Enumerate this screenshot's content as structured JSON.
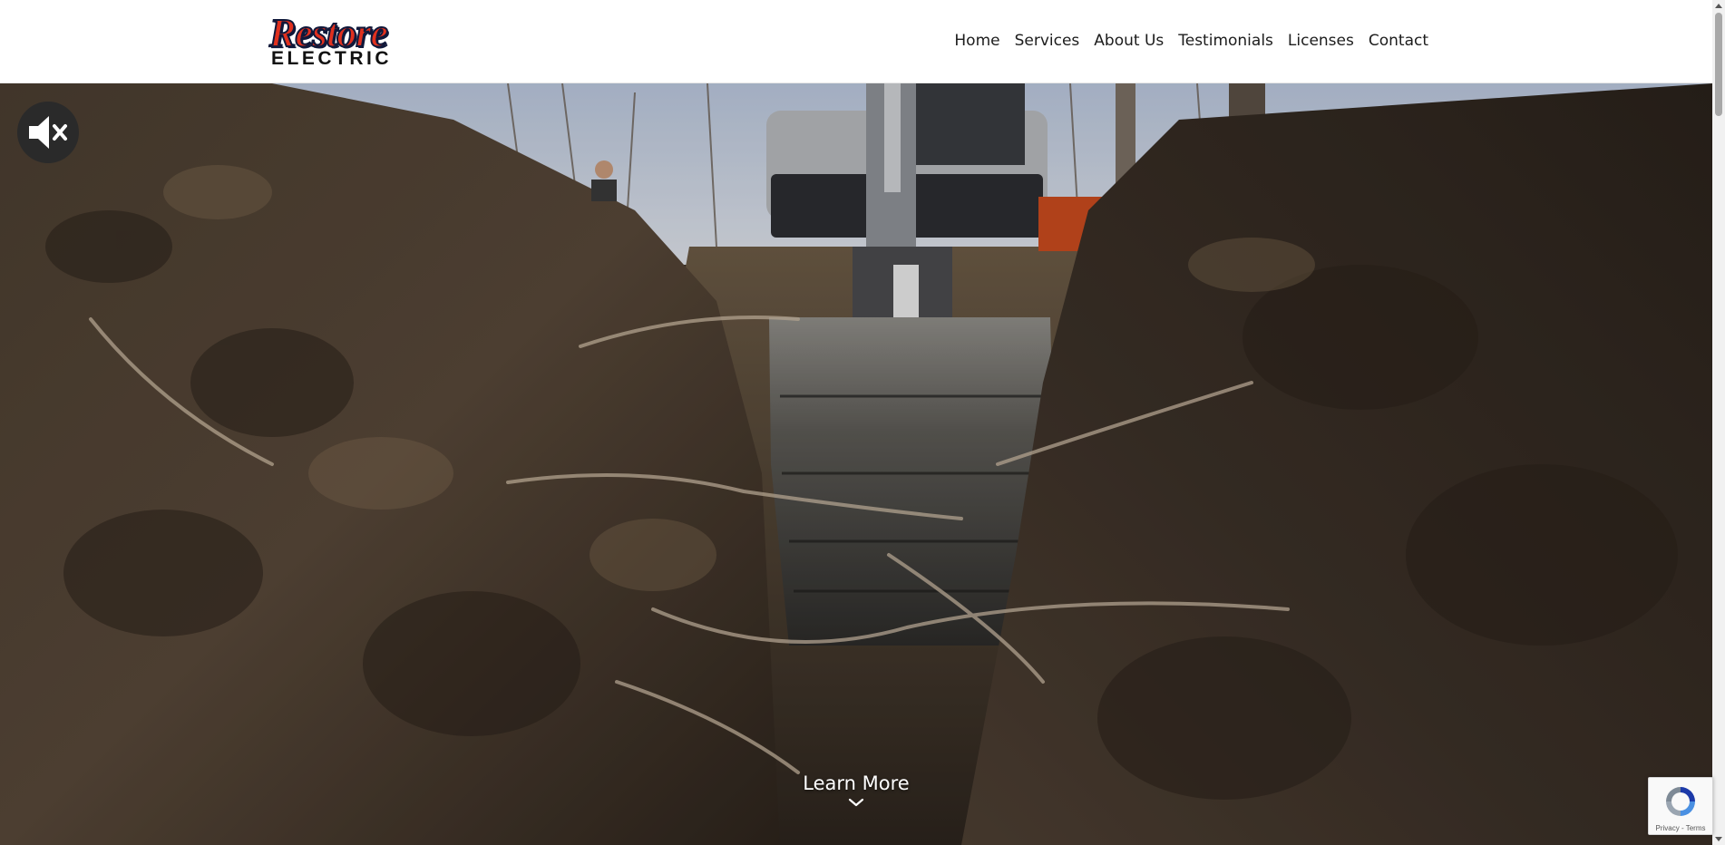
{
  "header": {
    "logo": {
      "line1": "Restore",
      "line2": "ELECTRIC"
    },
    "nav": [
      {
        "label": "Home"
      },
      {
        "label": "Services"
      },
      {
        "label": "About Us"
      },
      {
        "label": "Testimonials"
      },
      {
        "label": "Licenses"
      },
      {
        "label": "Contact"
      }
    ]
  },
  "hero": {
    "mute_icon": "speaker-muted-icon",
    "learn_more_label": "Learn More",
    "chevron_icon": "chevron-down-icon"
  },
  "recaptcha": {
    "terms_label": "Privacy - Terms"
  },
  "colors": {
    "logo_red": "#e0301e",
    "logo_navy": "#10183a",
    "nav_text": "#1c1c1c"
  }
}
